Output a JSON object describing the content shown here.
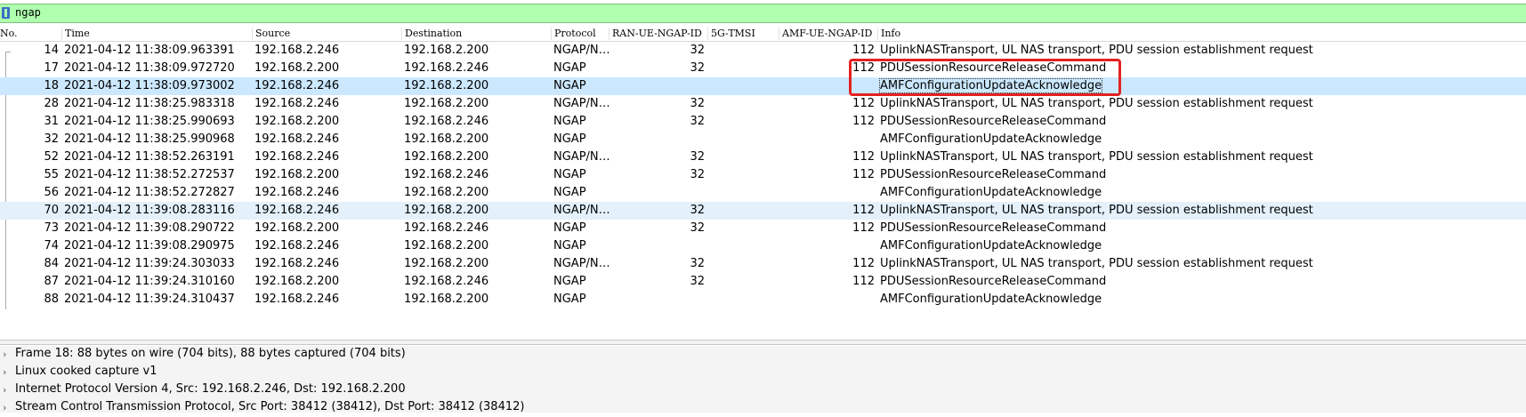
{
  "filter": {
    "value": "ngap"
  },
  "columns": [
    "No.",
    "Time",
    "Source",
    "Destination",
    "Protocol",
    "RAN-UE-NGAP-ID",
    "5G-TMSI",
    "AMF-UE-NGAP-ID",
    "Info"
  ],
  "packets": [
    {
      "no": "14",
      "time": "2021-04-12 11:38:09.963391",
      "src": "192.168.2.246",
      "dst": "192.168.2.200",
      "proto": "NGAP/N…",
      "ran": "32",
      "tmsi": "",
      "amf": "112",
      "info": "UplinkNASTransport, UL NAS transport, PDU session establishment request"
    },
    {
      "no": "17",
      "time": "2021-04-12 11:38:09.972720",
      "src": "192.168.2.200",
      "dst": "192.168.2.246",
      "proto": "NGAP",
      "ran": "32",
      "tmsi": "",
      "amf": "112",
      "info": "PDUSessionResourceReleaseCommand"
    },
    {
      "no": "18",
      "time": "2021-04-12 11:38:09.973002",
      "src": "192.168.2.246",
      "dst": "192.168.2.200",
      "proto": "NGAP",
      "ran": "",
      "tmsi": "",
      "amf": "",
      "info": "AMFConfigurationUpdateAcknowledge"
    },
    {
      "no": "28",
      "time": "2021-04-12 11:38:25.983318",
      "src": "192.168.2.246",
      "dst": "192.168.2.200",
      "proto": "NGAP/N…",
      "ran": "32",
      "tmsi": "",
      "amf": "112",
      "info": "UplinkNASTransport, UL NAS transport, PDU session establishment request"
    },
    {
      "no": "31",
      "time": "2021-04-12 11:38:25.990693",
      "src": "192.168.2.200",
      "dst": "192.168.2.246",
      "proto": "NGAP",
      "ran": "32",
      "tmsi": "",
      "amf": "112",
      "info": "PDUSessionResourceReleaseCommand"
    },
    {
      "no": "32",
      "time": "2021-04-12 11:38:25.990968",
      "src": "192.168.2.246",
      "dst": "192.168.2.200",
      "proto": "NGAP",
      "ran": "",
      "tmsi": "",
      "amf": "",
      "info": "AMFConfigurationUpdateAcknowledge"
    },
    {
      "no": "52",
      "time": "2021-04-12 11:38:52.263191",
      "src": "192.168.2.246",
      "dst": "192.168.2.200",
      "proto": "NGAP/N…",
      "ran": "32",
      "tmsi": "",
      "amf": "112",
      "info": "UplinkNASTransport, UL NAS transport, PDU session establishment request"
    },
    {
      "no": "55",
      "time": "2021-04-12 11:38:52.272537",
      "src": "192.168.2.200",
      "dst": "192.168.2.246",
      "proto": "NGAP",
      "ran": "32",
      "tmsi": "",
      "amf": "112",
      "info": "PDUSessionResourceReleaseCommand"
    },
    {
      "no": "56",
      "time": "2021-04-12 11:38:52.272827",
      "src": "192.168.2.246",
      "dst": "192.168.2.200",
      "proto": "NGAP",
      "ran": "",
      "tmsi": "",
      "amf": "",
      "info": "AMFConfigurationUpdateAcknowledge"
    },
    {
      "no": "70",
      "time": "2021-04-12 11:39:08.283116",
      "src": "192.168.2.246",
      "dst": "192.168.2.200",
      "proto": "NGAP/N…",
      "ran": "32",
      "tmsi": "",
      "amf": "112",
      "info": "UplinkNASTransport, UL NAS transport, PDU session establishment request"
    },
    {
      "no": "73",
      "time": "2021-04-12 11:39:08.290722",
      "src": "192.168.2.200",
      "dst": "192.168.2.246",
      "proto": "NGAP",
      "ran": "32",
      "tmsi": "",
      "amf": "112",
      "info": "PDUSessionResourceReleaseCommand"
    },
    {
      "no": "74",
      "time": "2021-04-12 11:39:08.290975",
      "src": "192.168.2.246",
      "dst": "192.168.2.200",
      "proto": "NGAP",
      "ran": "",
      "tmsi": "",
      "amf": "",
      "info": "AMFConfigurationUpdateAcknowledge"
    },
    {
      "no": "84",
      "time": "2021-04-12 11:39:24.303033",
      "src": "192.168.2.246",
      "dst": "192.168.2.200",
      "proto": "NGAP/N…",
      "ran": "32",
      "tmsi": "",
      "amf": "112",
      "info": "UplinkNASTransport, UL NAS transport, PDU session establishment request"
    },
    {
      "no": "87",
      "time": "2021-04-12 11:39:24.310160",
      "src": "192.168.2.200",
      "dst": "192.168.2.246",
      "proto": "NGAP",
      "ran": "32",
      "tmsi": "",
      "amf": "112",
      "info": "PDUSessionResourceReleaseCommand"
    },
    {
      "no": "88",
      "time": "2021-04-12 11:39:24.310437",
      "src": "192.168.2.246",
      "dst": "192.168.2.200",
      "proto": "NGAP",
      "ran": "",
      "tmsi": "",
      "amf": "",
      "info": "AMFConfigurationUpdateAcknowledge"
    }
  ],
  "selected_packet": "18",
  "highlighted_packet": "70",
  "details": [
    "Frame 18: 88 bytes on wire (704 bits), 88 bytes captured (704 bits)",
    "Linux cooked capture v1",
    "Internet Protocol Version 4, Src: 192.168.2.246, Dst: 192.168.2.200",
    "Stream Control Transmission Protocol, Src Port: 38412 (38412), Dst Port: 38412 (38412)"
  ],
  "colors": {
    "filter_bg": "#afffaf",
    "selected_row": "#cce8ff",
    "highlighted_row": "#e4f1fb",
    "annotation": "#e32121"
  },
  "icons": {
    "filter": "bookmark-icon",
    "expand": "chevron-right-icon"
  }
}
